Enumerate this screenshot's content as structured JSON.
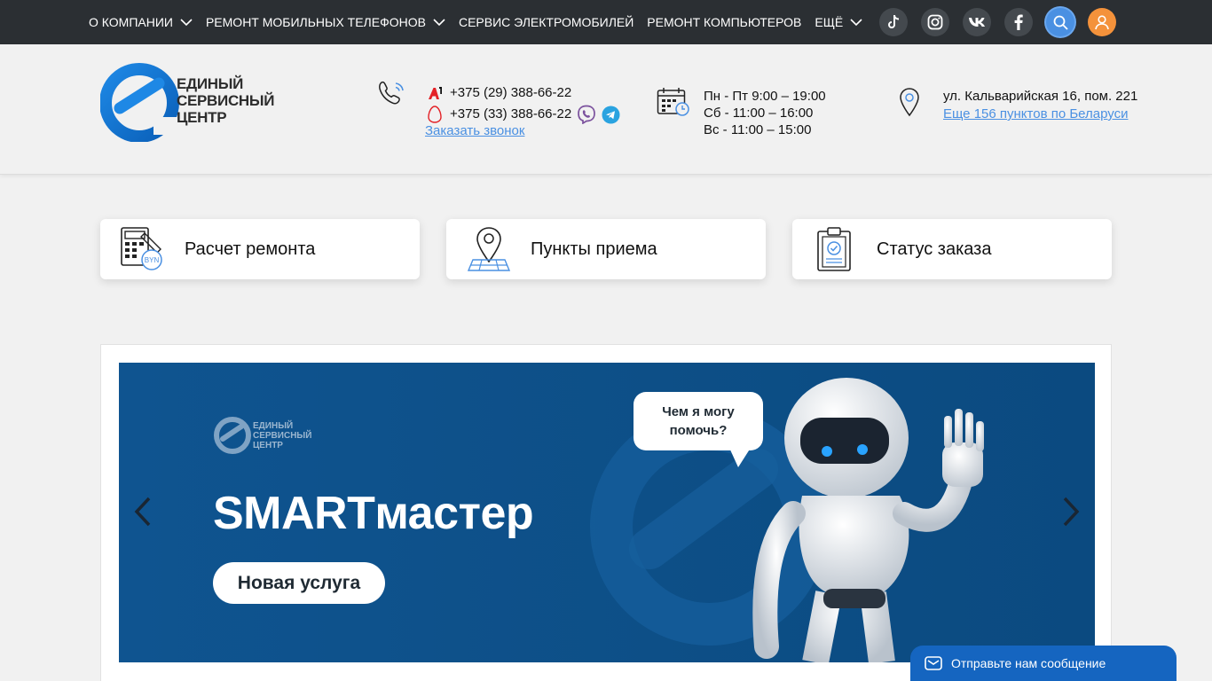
{
  "nav": {
    "items": [
      {
        "label": "О КОМПАНИИ",
        "has_dropdown": true
      },
      {
        "label": "РЕМОНТ МОБИЛЬНЫХ ТЕЛЕФОНОВ",
        "has_dropdown": true
      },
      {
        "label": "СЕРВИС ЭЛЕКТРОМОБИЛЕЙ",
        "has_dropdown": false
      },
      {
        "label": "РЕМОНТ КОМПЬЮТЕРОВ",
        "has_dropdown": false
      },
      {
        "label": "ЕЩЁ",
        "has_dropdown": true
      }
    ],
    "socials": [
      "tiktok-icon",
      "instagram-icon",
      "vk-icon",
      "facebook-icon",
      "search-icon",
      "user-icon"
    ]
  },
  "header": {
    "logo_text": [
      "ЕДИНЫЙ",
      "СЕРВИСНЫЙ",
      "ЦЕНТР"
    ],
    "phones": [
      {
        "operator": "A1",
        "number": "+375 (29) 388-66-22"
      },
      {
        "operator": "MTS",
        "number": "+375 (33) 388-66-22"
      }
    ],
    "callback_label": "Заказать звонок",
    "hours": [
      "Пн - Пт 9:00 – 19:00",
      "Сб - 11:00 – 16:00",
      "Вс - 11:00 – 15:00"
    ],
    "address": "ул. Кальварийская 16, пом. 221",
    "more_points": "Еще 156 пунктов по Беларуси"
  },
  "cards": [
    {
      "label": "Расчет ремонта",
      "icon": "calculator-icon"
    },
    {
      "label": "Пункты приема",
      "icon": "location-map-icon"
    },
    {
      "label": "Статус заказа",
      "icon": "clipboard-check-icon"
    }
  ],
  "banner": {
    "logo_text": [
      "ЕДИНЫЙ",
      "СЕРВИСНЫЙ",
      "ЦЕНТР"
    ],
    "title": "SMARTмастер",
    "button_label": "Новая услуга",
    "bubble_text": [
      "Чем я могу",
      "помочь?"
    ]
  },
  "chat": {
    "label": "Отправьте нам сообщение"
  },
  "colors": {
    "topbar": "#2b2f33",
    "accent_blue": "#4a90e2",
    "brand_blue": "#1e88e5",
    "user_orange": "#f4923b",
    "banner_bg": "#0d4f87"
  }
}
